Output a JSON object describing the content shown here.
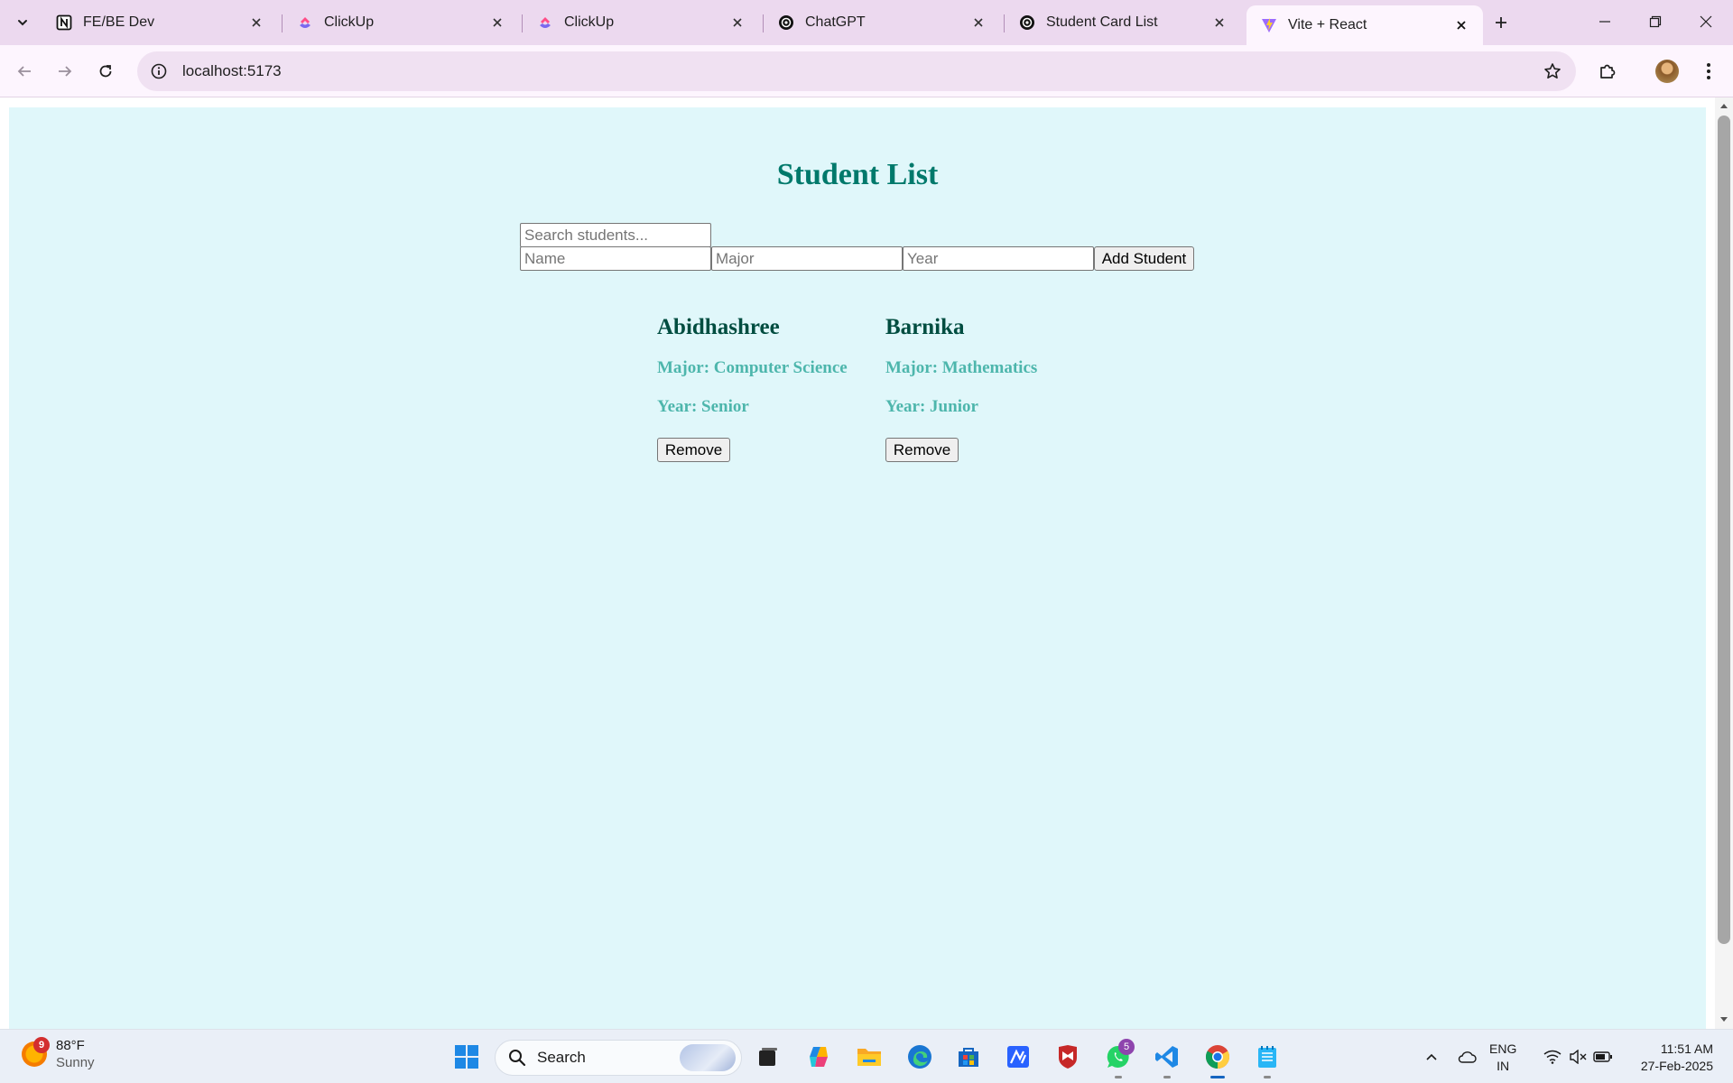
{
  "browser": {
    "tabs": [
      {
        "title": "FE/BE Dev",
        "icon": "notion-icon",
        "active": false
      },
      {
        "title": "ClickUp",
        "icon": "clickup-icon",
        "active": false
      },
      {
        "title": "ClickUp",
        "icon": "clickup-icon",
        "active": false
      },
      {
        "title": "ChatGPT",
        "icon": "chatgpt-icon",
        "active": false
      },
      {
        "title": "Student Card List",
        "icon": "chatgpt-icon",
        "active": false
      },
      {
        "title": "Vite + React",
        "icon": "vite-icon",
        "active": true
      }
    ],
    "url": "localhost:5173"
  },
  "page": {
    "title": "Student List",
    "search_placeholder": "Search students...",
    "name_placeholder": "Name",
    "major_placeholder": "Major",
    "year_placeholder": "Year",
    "add_button": "Add Student",
    "students": [
      {
        "name": "Abidhashree",
        "major": "Major: Computer Science",
        "year": "Year: Senior",
        "remove": "Remove"
      },
      {
        "name": "Barnika",
        "major": "Major: Mathematics",
        "year": "Year: Junior",
        "remove": "Remove"
      }
    ],
    "colors": {
      "background": "#e0f7fa",
      "heading": "#00796b",
      "card_name": "#004d40",
      "card_detail": "#4db6ac"
    }
  },
  "taskbar": {
    "weather": {
      "temp": "88°F",
      "condition": "Sunny",
      "badge": "9"
    },
    "search_label": "Search",
    "whatsapp_badge": "5",
    "language": {
      "line1": "ENG",
      "line2": "IN"
    },
    "time": "11:51 AM",
    "date": "27-Feb-2025"
  }
}
